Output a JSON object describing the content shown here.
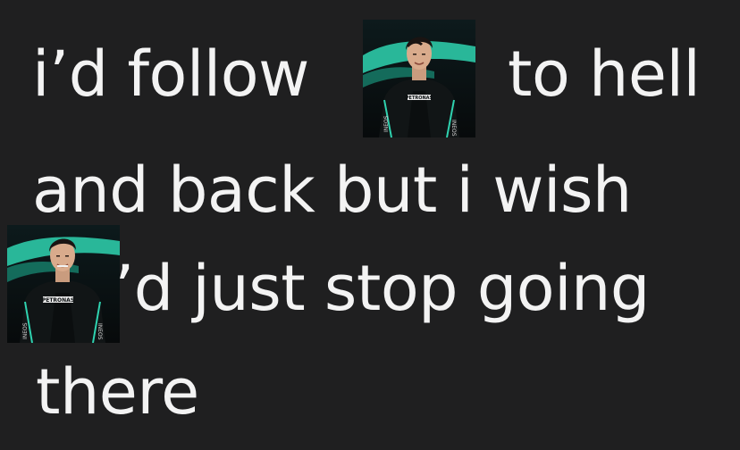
{
  "post": {
    "line1": {
      "before": "i’d follow",
      "after": "to hell"
    },
    "line2": "and back but i wish",
    "line3": {
      "after": "’d just stop going"
    },
    "line4": "there"
  },
  "photo": {
    "suit_text": "PETRONAS",
    "sleeve_left": "INEOS",
    "sleeve_right": "INEOS",
    "accent_color": "#2fd3b0"
  }
}
